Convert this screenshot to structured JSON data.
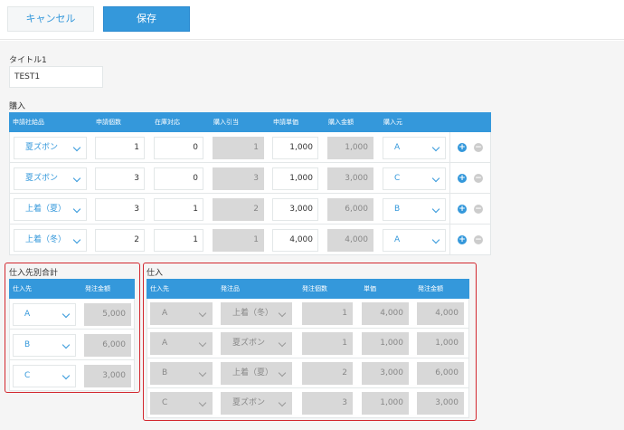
{
  "toolbar": {
    "cancel_label": "キャンセル",
    "save_label": "保存"
  },
  "title_field": {
    "label": "タイトル1",
    "value": "TEST1"
  },
  "purchase": {
    "label": "購入",
    "headers": [
      "申請社給品",
      "申請個数",
      "在庫対応",
      "購入引当",
      "申請単価",
      "購入金額",
      "購入元"
    ],
    "rows": [
      {
        "item": "夏ズボン",
        "qty": "1",
        "stock": "0",
        "alloc": "1",
        "unit": "1,000",
        "amount": "1,000",
        "vendor": "A"
      },
      {
        "item": "夏ズボン",
        "qty": "3",
        "stock": "0",
        "alloc": "3",
        "unit": "1,000",
        "amount": "3,000",
        "vendor": "C"
      },
      {
        "item": "上着（夏）",
        "qty": "3",
        "stock": "1",
        "alloc": "2",
        "unit": "3,000",
        "amount": "6,000",
        "vendor": "B"
      },
      {
        "item": "上着（冬）",
        "qty": "2",
        "stock": "1",
        "alloc": "1",
        "unit": "4,000",
        "amount": "4,000",
        "vendor": "A"
      }
    ]
  },
  "vendor_totals": {
    "label": "仕入先別合計",
    "headers": [
      "仕入先",
      "発注金額"
    ],
    "rows": [
      {
        "vendor": "A",
        "amount": "5,000"
      },
      {
        "vendor": "B",
        "amount": "6,000"
      },
      {
        "vendor": "C",
        "amount": "3,000"
      }
    ]
  },
  "orders": {
    "label": "仕入",
    "headers": [
      "仕入先",
      "発注品",
      "発注個数",
      "単価",
      "発注金額"
    ],
    "rows": [
      {
        "vendor": "A",
        "item": "上着（冬）",
        "qty": "1",
        "unit": "4,000",
        "amount": "4,000"
      },
      {
        "vendor": "A",
        "item": "夏ズボン",
        "qty": "1",
        "unit": "1,000",
        "amount": "1,000"
      },
      {
        "vendor": "B",
        "item": "上着（夏）",
        "qty": "2",
        "unit": "3,000",
        "amount": "6,000"
      },
      {
        "vendor": "C",
        "item": "夏ズボン",
        "qty": "3",
        "unit": "1,000",
        "amount": "3,000"
      }
    ]
  },
  "icons": {
    "add": "plus-circle-icon",
    "remove": "minus-circle-icon",
    "dropdown": "chevron-down-icon"
  },
  "colors": {
    "accent": "#3498db",
    "highlight": "#d3282f",
    "readonly": "#d8d8d8"
  }
}
